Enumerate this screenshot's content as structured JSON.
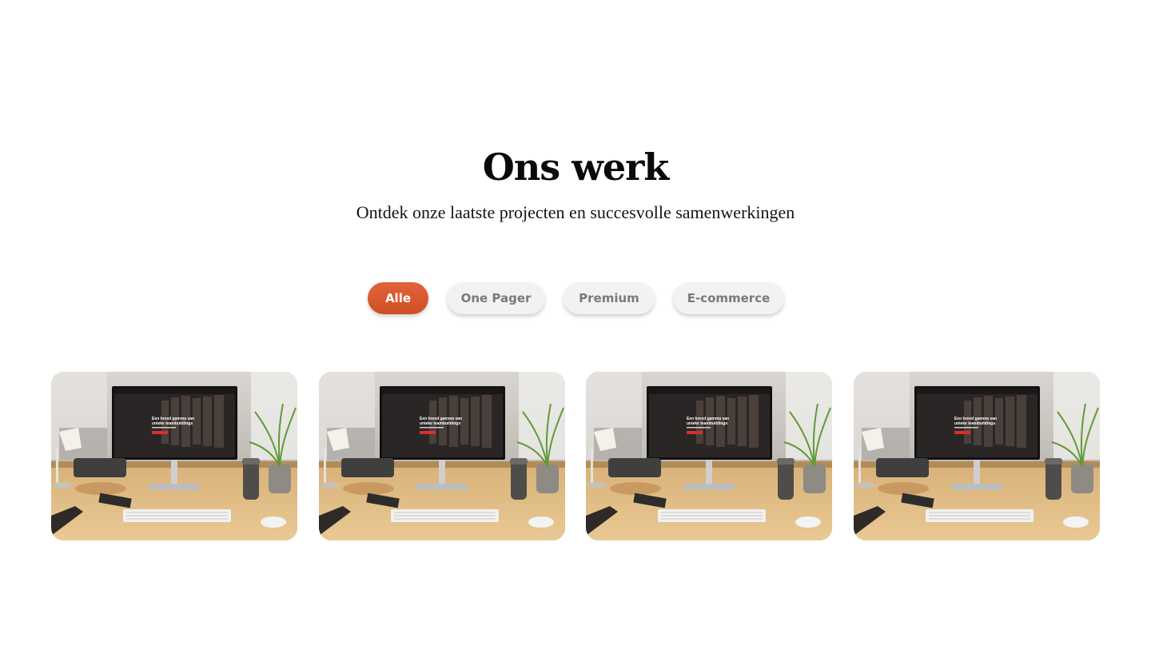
{
  "section": {
    "title": "Ons werk",
    "subtitle": "Ontdek onze laatste projecten en succesvolle samenwerkingen"
  },
  "filters": [
    {
      "label": "Alle",
      "active": true
    },
    {
      "label": "One Pager",
      "active": false
    },
    {
      "label": "Premium",
      "active": false
    },
    {
      "label": "E-commerce",
      "active": false
    }
  ],
  "projects": [
    {
      "screen_headline_1": "Een breed gamma van",
      "screen_headline_2": "unieke teambuildings"
    },
    {
      "screen_headline_1": "Een breed gamma van",
      "screen_headline_2": "unieke teambuildings"
    },
    {
      "screen_headline_1": "Een breed gamma van",
      "screen_headline_2": "unieke teambuildings"
    },
    {
      "screen_headline_1": "Een breed gamma van",
      "screen_headline_2": "unieke teambuildings"
    }
  ],
  "colors": {
    "accent": "#d9572d",
    "chip_bg": "#f2f2f2",
    "chip_text": "#7a7a7a"
  }
}
